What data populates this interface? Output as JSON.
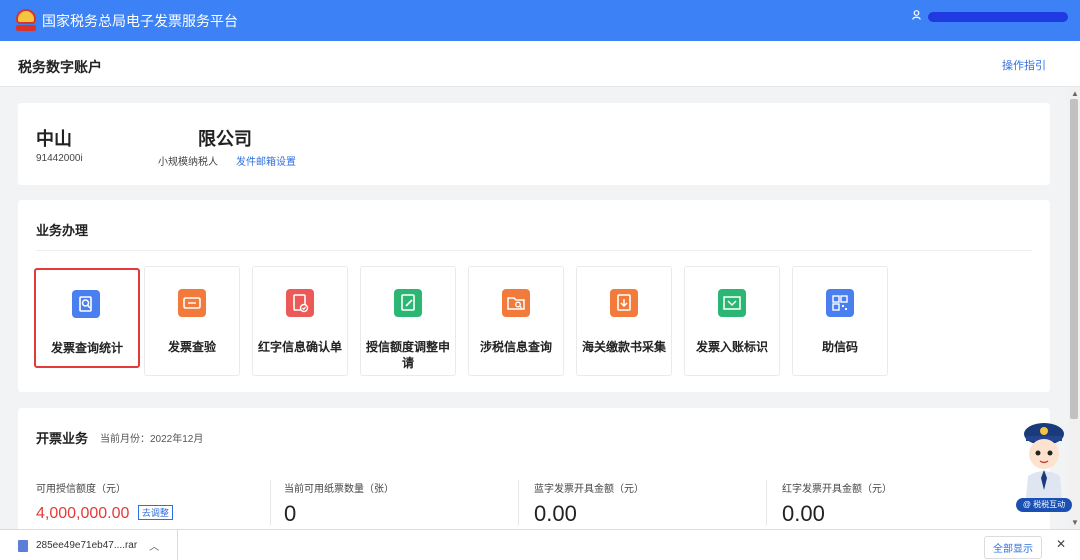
{
  "header": {
    "app_title": "国家税务总局电子发票服务平台"
  },
  "page": {
    "title": "税务数字账户",
    "guide_link": "操作指引"
  },
  "company": {
    "name_part1": "中山",
    "name_part2": "限公司",
    "tax_id": "91442000i",
    "taxpayer_type": "小规模纳税人",
    "mail_setting_link": "发件邮箱设置"
  },
  "business": {
    "title": "业务办理",
    "tiles": [
      {
        "label": "发票查询统计",
        "color": "#4a7ff0",
        "icon": "search-doc-icon",
        "selected": true
      },
      {
        "label": "发票查验",
        "color": "#f27a3a",
        "icon": "ticket-icon"
      },
      {
        "label": "红字信息确认单",
        "color": "#ec5a58",
        "icon": "doc-check-icon"
      },
      {
        "label": "授信额度调整申请",
        "color": "#2bb673",
        "icon": "edit-doc-icon"
      },
      {
        "label": "涉税信息查询",
        "color": "#f27a3a",
        "icon": "folder-search-icon"
      },
      {
        "label": "海关缴款书采集",
        "color": "#f27a3a",
        "icon": "download-doc-icon"
      },
      {
        "label": "发票入账标识",
        "color": "#2bb673",
        "icon": "inbox-icon"
      },
      {
        "label": "助信码",
        "color": "#4a7ff0",
        "icon": "qr-code-icon"
      }
    ]
  },
  "billing": {
    "title": "开票业务",
    "month_label": "当前月份：2022年12月",
    "stats": [
      {
        "label": "可用授信额度（元）",
        "value": "4,000,000.00",
        "action": "去调整"
      },
      {
        "label": "当前可用纸票数量（张）",
        "value": "0"
      },
      {
        "label": "蓝字发票开具金额（元）",
        "value": "0.00"
      },
      {
        "label": "红字发票开具金额（元）",
        "value": "0.00"
      }
    ]
  },
  "mascot": {
    "badge": "@ 税税互动"
  },
  "downloads": {
    "file_name": "285ee49e71eb47....rar",
    "show_all": "全部显示"
  },
  "colors": {
    "topbar": "#3c82f6",
    "link": "#2f6fe0",
    "highlight": "#e23a3a"
  }
}
